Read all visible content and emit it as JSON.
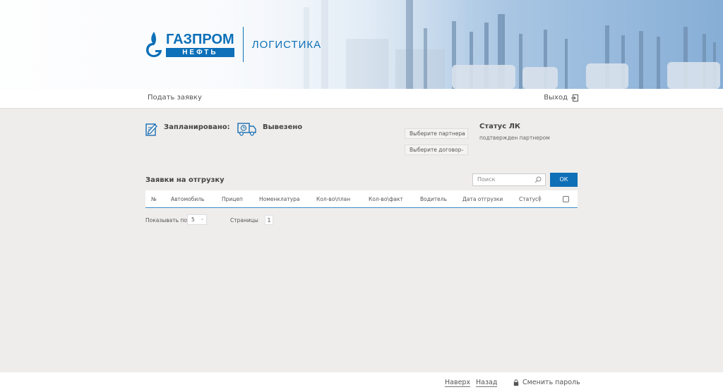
{
  "header": {
    "logo_top": "ГАЗПРОМ",
    "logo_bottom": "НЕФТЬ",
    "title": "ЛОГИСТИКА"
  },
  "nav": {
    "submit": "Подать заявку",
    "logout": "Выход"
  },
  "stats": {
    "planned_label": "Запланировано:",
    "exported_label": "Вывезено"
  },
  "filters": {
    "partner": "Выберите партнера",
    "contract": "Выберите договор"
  },
  "status": {
    "title": "Статус ЛК",
    "value": "подтвержден партнером"
  },
  "section": {
    "title": "Заявки на отгрузку",
    "search_placeholder": "Поиск",
    "ok": "ОК"
  },
  "table": {
    "columns": [
      "№",
      "Автомобиль",
      "Прицеп",
      "Номенклатура",
      "Кол-во\\план",
      "Кол-во\\факт",
      "Водитель",
      "Дата отгрузки",
      "Статус"
    ]
  },
  "pagination": {
    "show_label": "Показывать по",
    "page_size": "5",
    "pages_label": "Страницы",
    "current_page": "1"
  },
  "footer": {
    "top": "Наверх",
    "back": "Назад",
    "change_password": "Сменить пароль"
  },
  "colors": {
    "brand": "#0d70b8",
    "button": "#0f6fb7",
    "background": "#efedeb"
  }
}
